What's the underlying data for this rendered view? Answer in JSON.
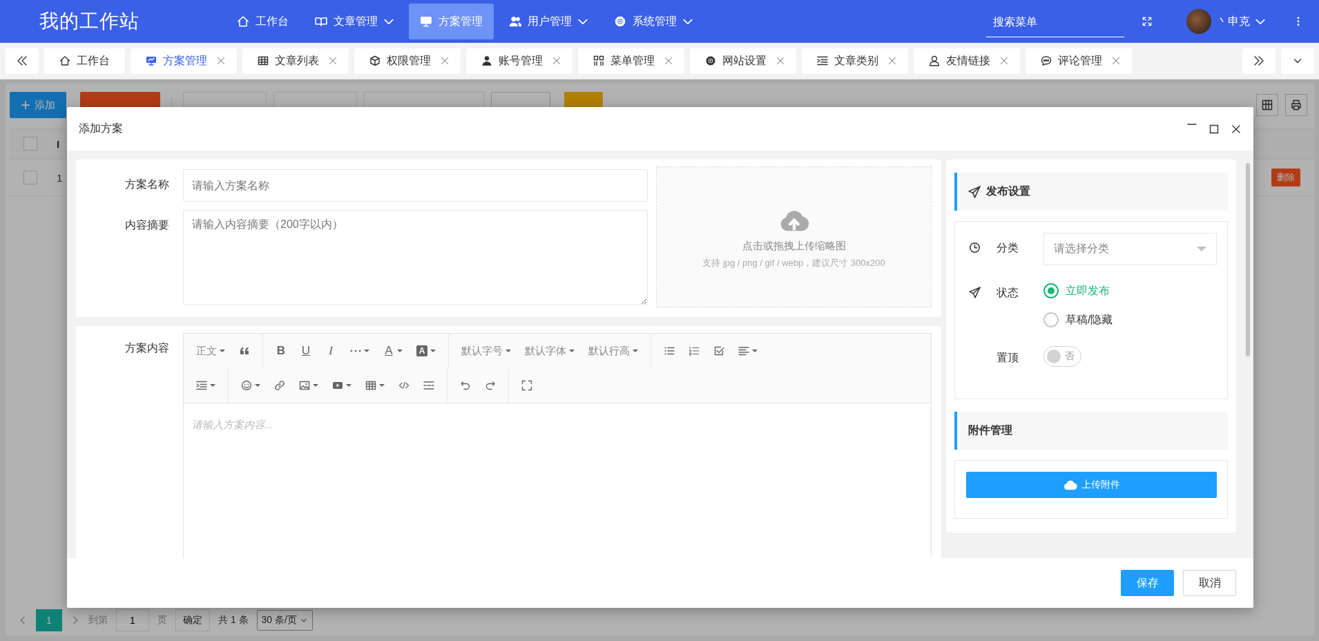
{
  "app_title": "我的工作站",
  "nav": [
    {
      "label": "工作台",
      "selected": false,
      "dropdown": false
    },
    {
      "label": "文章管理",
      "selected": false,
      "dropdown": true
    },
    {
      "label": "方案管理",
      "selected": true,
      "dropdown": false
    },
    {
      "label": "用户管理",
      "selected": false,
      "dropdown": true
    },
    {
      "label": "系统管理",
      "selected": false,
      "dropdown": true
    }
  ],
  "menu_search": {
    "placeholder": "搜索菜单"
  },
  "user": {
    "name": "丶申克"
  },
  "tabs": [
    {
      "label": "工作台",
      "selected": false,
      "closable": false
    },
    {
      "label": "方案管理",
      "selected": true,
      "closable": true
    },
    {
      "label": "文章列表",
      "selected": false,
      "closable": true
    },
    {
      "label": "权限管理",
      "selected": false,
      "closable": true
    },
    {
      "label": "账号管理",
      "selected": false,
      "closable": true
    },
    {
      "label": "菜单管理",
      "selected": false,
      "closable": true
    },
    {
      "label": "网站设置",
      "selected": false,
      "closable": true
    },
    {
      "label": "文章类别",
      "selected": false,
      "closable": true
    },
    {
      "label": "友情链接",
      "selected": false,
      "closable": true
    },
    {
      "label": "评论管理",
      "selected": false,
      "closable": true
    }
  ],
  "toolbar": {
    "add": "添加"
  },
  "table": {
    "header_checked": false,
    "columns": [
      "I"
    ],
    "rows": [
      {
        "checked": false,
        "cells": [
          "1"
        ],
        "action": "删除"
      }
    ]
  },
  "pagination": {
    "pages": [
      {
        "label": "1",
        "selected": true
      }
    ],
    "goto_label": "到第",
    "goto_value": "1",
    "page_unit": "页",
    "confirm": "确定",
    "total": "共 1 条",
    "page_size": "30 条/页"
  },
  "dialog": {
    "title": "添加方案",
    "name_field": {
      "label": "方案名称",
      "placeholder": "请输入方案名称"
    },
    "summary_field": {
      "label": "内容摘要",
      "placeholder": "请输入内容摘要（200字以内）"
    },
    "upload": {
      "title": "点击或拖拽上传缩略图",
      "hint": "支持 jpg / png / gif / webp，建议尺寸 300x200"
    },
    "editor": {
      "label": "方案内容",
      "placeholder": "请输入方案内容...",
      "rows": [
        [
          [
            {
              "kind": "dropdown",
              "label": "正文"
            },
            {
              "kind": "icon",
              "caret": false
            }
          ],
          [
            {
              "kind": "glyph",
              "label": "B",
              "caret": false
            },
            {
              "kind": "glyph",
              "label": "U",
              "caret": false
            },
            {
              "kind": "glyph",
              "label": "I",
              "caret": false
            },
            {
              "kind": "icon",
              "caret": true
            },
            {
              "kind": "glyph",
              "label": "A",
              "caret": true
            },
            {
              "kind": "glyph",
              "label": "A",
              "caret": true
            }
          ],
          [
            {
              "kind": "dropdown",
              "label": "默认字号"
            },
            {
              "kind": "dropdown",
              "label": "默认字体"
            },
            {
              "kind": "dropdown",
              "label": "默认行高"
            }
          ],
          [
            {
              "kind": "icon",
              "caret": false
            },
            {
              "kind": "icon",
              "caret": false
            },
            {
              "kind": "icon",
              "caret": false
            },
            {
              "kind": "icon",
              "caret": true
            }
          ]
        ],
        [
          [
            {
              "kind": "icon",
              "caret": true
            }
          ],
          [
            {
              "kind": "icon",
              "caret": true
            },
            {
              "kind": "icon",
              "caret": false
            },
            {
              "kind": "icon",
              "caret": true
            },
            {
              "kind": "icon",
              "caret": true
            },
            {
              "kind": "icon",
              "caret": true
            },
            {
              "kind": "icon",
              "caret": false
            },
            {
              "kind": "icon",
              "caret": false
            }
          ],
          [
            {
              "kind": "icon",
              "caret": false
            },
            {
              "kind": "icon",
              "caret": false
            }
          ],
          [
            {
              "kind": "icon",
              "caret": false
            }
          ]
        ]
      ]
    },
    "publish": {
      "heading": "发布设置",
      "category": {
        "label": "分类",
        "placeholder": "请选择分类"
      },
      "status": {
        "label": "状态",
        "options": [
          {
            "label": "立即发布",
            "selected": true
          },
          {
            "label": "草稿/隐藏",
            "selected": false
          }
        ]
      },
      "pin": {
        "label": "置顶",
        "on": false,
        "text": "否"
      }
    },
    "attachments": {
      "heading": "附件管理",
      "button": "上传附件"
    },
    "buttons": [
      {
        "label": "保存",
        "kind": "primary"
      },
      {
        "label": "取消",
        "kind": "default"
      }
    ]
  }
}
